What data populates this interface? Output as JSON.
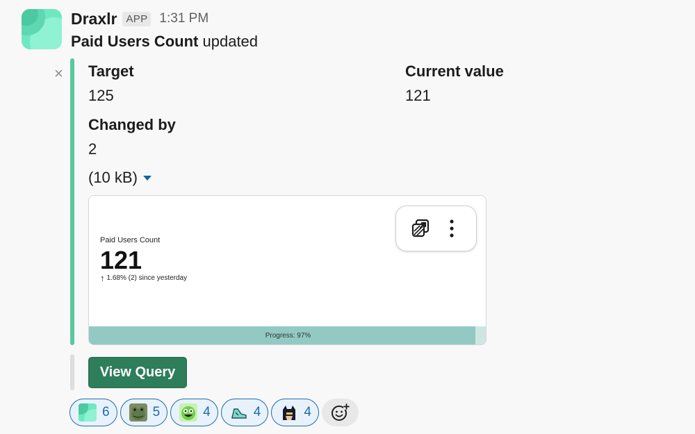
{
  "message": {
    "app_name": "Draxlr",
    "app_badge": "APP",
    "timestamp": "1:31 PM",
    "metric_name": "Paid Users Count",
    "action_text": "updated"
  },
  "fields": {
    "target_label": "Target",
    "target_value": "125",
    "current_label": "Current value",
    "current_value": "121",
    "changed_label": "Changed by",
    "changed_value": "2"
  },
  "attachment": {
    "file_size": "(10 kB)",
    "card_title": "Paid Users Count",
    "card_value": "121",
    "change_arrow": "↑",
    "change_text": "1.68% (2) since yesterday",
    "progress_label": "Progress: 97%",
    "progress_fraction": 0.97
  },
  "action": {
    "view_query_label": "View Query"
  },
  "reactions": [
    {
      "emoji": "draxlr-logo-emoji",
      "count": "6"
    },
    {
      "emoji": "frog-emoji",
      "count": "5"
    },
    {
      "emoji": "green-monster-emoji",
      "count": "4"
    },
    {
      "emoji": "shoe-emoji",
      "count": "4"
    },
    {
      "emoji": "batman-emoji",
      "count": "4"
    }
  ],
  "colors": {
    "attachment_bar": "#58c89e",
    "view_query_button": "#2e7d5b",
    "reaction_border": "#1d6ab0",
    "progress_fill": "#93c9c3"
  }
}
